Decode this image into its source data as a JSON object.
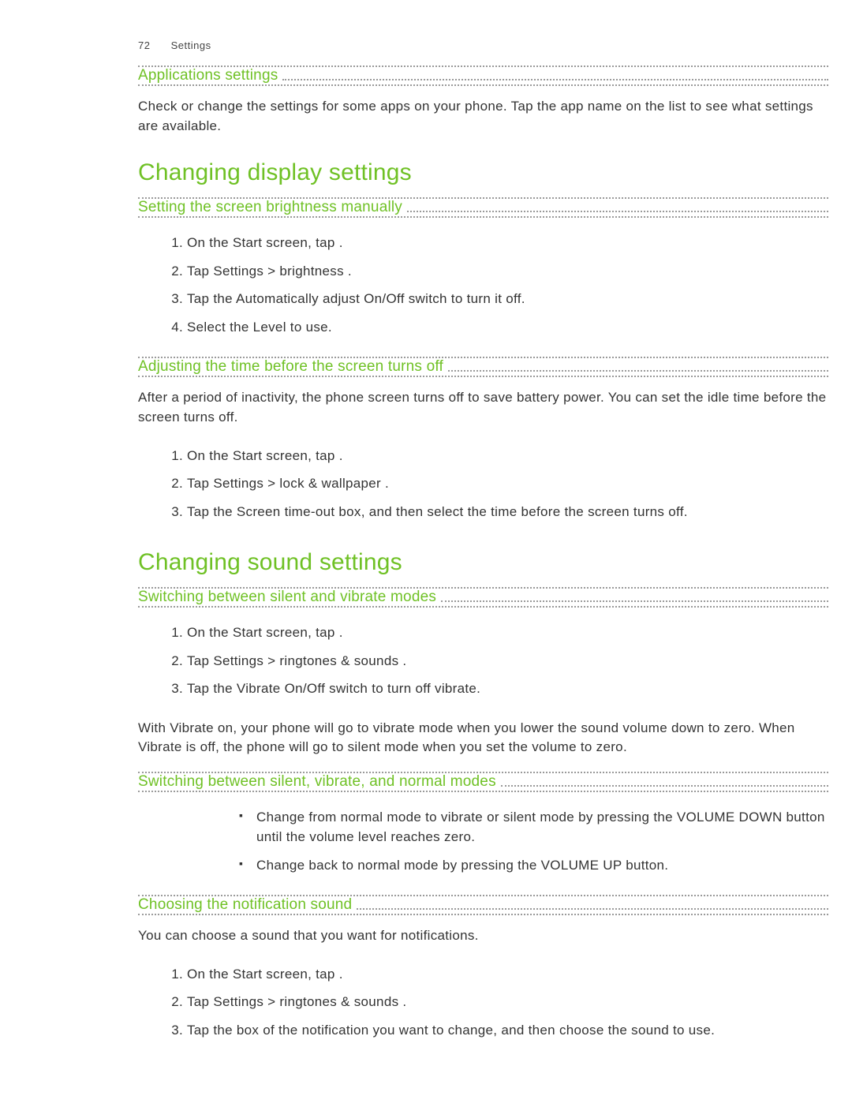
{
  "header": {
    "page_number": "72",
    "section": "Settings"
  },
  "s_app": {
    "title": "Applications settings",
    "para": "Check or change the settings for some apps on your phone. Tap the app name on the list to see what settings are available."
  },
  "h_display": "Changing display settings",
  "s_bright": {
    "title": "Setting the screen brightness manually",
    "steps": [
      "On the Start screen, tap      .",
      "Tap Settings  > brightness .",
      "Tap the Automatically adjust    On/Off switch to turn it off.",
      "Select the Level  to use."
    ]
  },
  "s_timeout": {
    "title": "Adjusting the time before the screen turns off",
    "para": "After a period of inactivity, the phone screen turns off to save battery power. You can set the idle time before the screen turns off.",
    "steps": [
      "On the Start screen, tap      .",
      "Tap Settings  > lock & wallpaper  .",
      "Tap the Screen time-out   box, and then select the time before the screen turns off."
    ]
  },
  "h_sound": "Changing sound settings",
  "s_vibrate": {
    "title": "Switching between silent and vibrate modes",
    "steps": [
      "On the Start screen, tap      .",
      "Tap Settings  > ringtones & sounds  .",
      "Tap the Vibrate  On/Off switch to turn off vibrate."
    ],
    "para": "With Vibrate on, your phone will go to vibrate mode when you lower the sound volume down to zero. When Vibrate is off, the phone will go to silent mode when you set the volume to zero."
  },
  "s_modes": {
    "title": "Switching between silent, vibrate, and normal modes",
    "bullets": [
      "Change from normal mode to vibrate or silent mode by pressing the VOLUME DOWN button until the volume level reaches zero.",
      "Change back to normal mode by pressing the VOLUME UP button."
    ]
  },
  "s_notif": {
    "title": "Choosing the   notification sound",
    "para": "You can choose a sound that you want for notifications.",
    "steps": [
      "On the Start screen, tap      .",
      "Tap Settings  > ringtones & sounds  .",
      "Tap the box of the notification you want to change, and then choose the sound to use."
    ]
  }
}
